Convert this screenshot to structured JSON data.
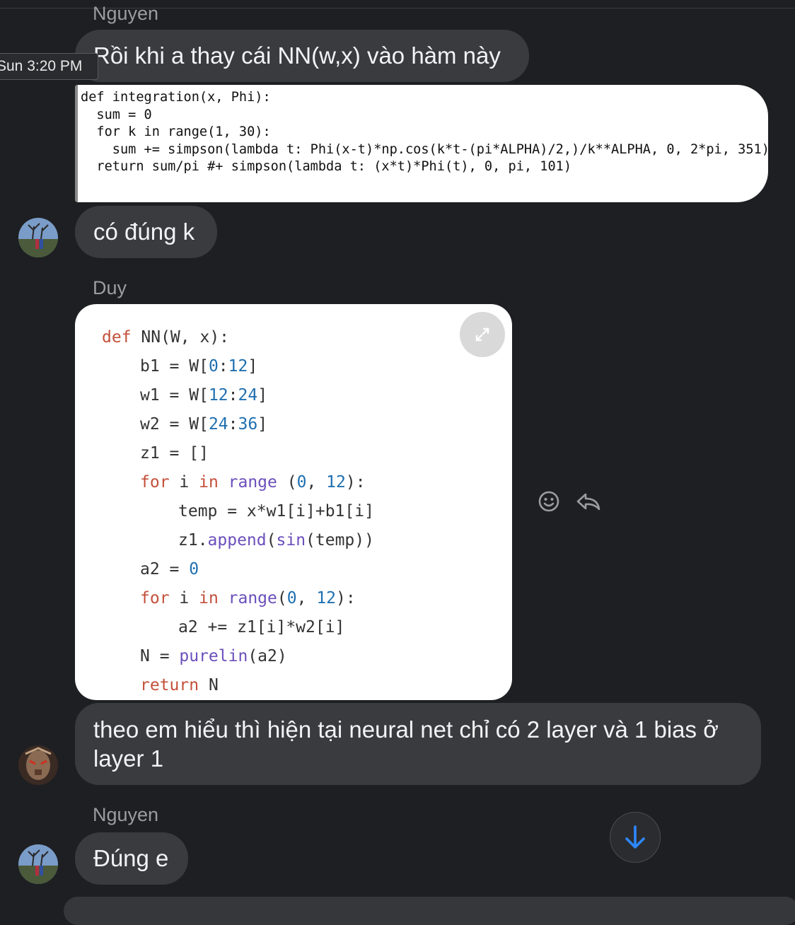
{
  "messages": {
    "sender_nguyen_top": "Nguyen",
    "msg1": "Rồi khi a thay cái NN(w,x) vào hàm này",
    "timestamp": "Sun 3:20 PM",
    "code1": [
      "def integration(x, Phi):",
      "  sum = 0",
      "  for k in range(1, 30):",
      "    sum += simpson(lambda t: Phi(x-t)*np.cos(k*t-(pi*ALPHA)/2,)/k**ALPHA, 0, 2*pi, 351)",
      "  return sum/pi #+ simpson(lambda t: (x*t)*Phi(t), 0, pi, 101)"
    ],
    "msg2": "có đúng k",
    "sender_duy": "Duy",
    "msg3_line1": "theo em hiểu thì hiện tại neural net chỉ có 2 layer và 1 bias ở",
    "msg3_line2": "layer 1",
    "sender_nguyen_bottom": "Nguyen",
    "msg4": "Đúng e"
  },
  "code2": {
    "l1_kw": "def",
    "l1_rest": " NN(W, x):",
    "l2_a": "b1 = W[",
    "l2_n1": "0",
    "l2_b": ":",
    "l2_n2": "12",
    "l2_c": "]",
    "l3_a": "w1 = W[",
    "l3_n1": "12",
    "l3_b": ":",
    "l3_n2": "24",
    "l3_c": "]",
    "l4_a": "w2 = W[",
    "l4_n1": "24",
    "l4_b": ":",
    "l4_n2": "36",
    "l4_c": "]",
    "l5": "z1 = []",
    "l6_for": "for",
    "l6_i": " i ",
    "l6_in": "in",
    "l6_range": " range",
    "l6_a": " (",
    "l6_n1": "0",
    "l6_b": ", ",
    "l6_n2": "12",
    "l6_c": "):",
    "l7": "temp = x*w1[i]+b1[i]",
    "l8_a": "z1.",
    "l8_append": "append",
    "l8_b": "(",
    "l8_sin": "sin",
    "l8_c": "(temp))",
    "l9_a": "a2 = ",
    "l9_n": "0",
    "l10_for": "for",
    "l10_i": " i ",
    "l10_in": "in",
    "l10_range": " range",
    "l10_a": "(",
    "l10_n1": "0",
    "l10_b": ", ",
    "l10_n2": "12",
    "l10_c": "):",
    "l11": "a2 += z1[i]*w2[i]",
    "l12_a": "N = ",
    "l12_fn": "purelin",
    "l12_b": "(a2)",
    "l13_kw": "return",
    "l13_rest": " N"
  },
  "icons": {
    "expand": "expand-icon",
    "emoji": "smiley-icon",
    "reply": "reply-icon",
    "scroll": "arrow-down-icon"
  },
  "colors": {
    "accent": "#2d88ff",
    "bubble": "#3a3b3f",
    "background": "#1e1f22"
  }
}
